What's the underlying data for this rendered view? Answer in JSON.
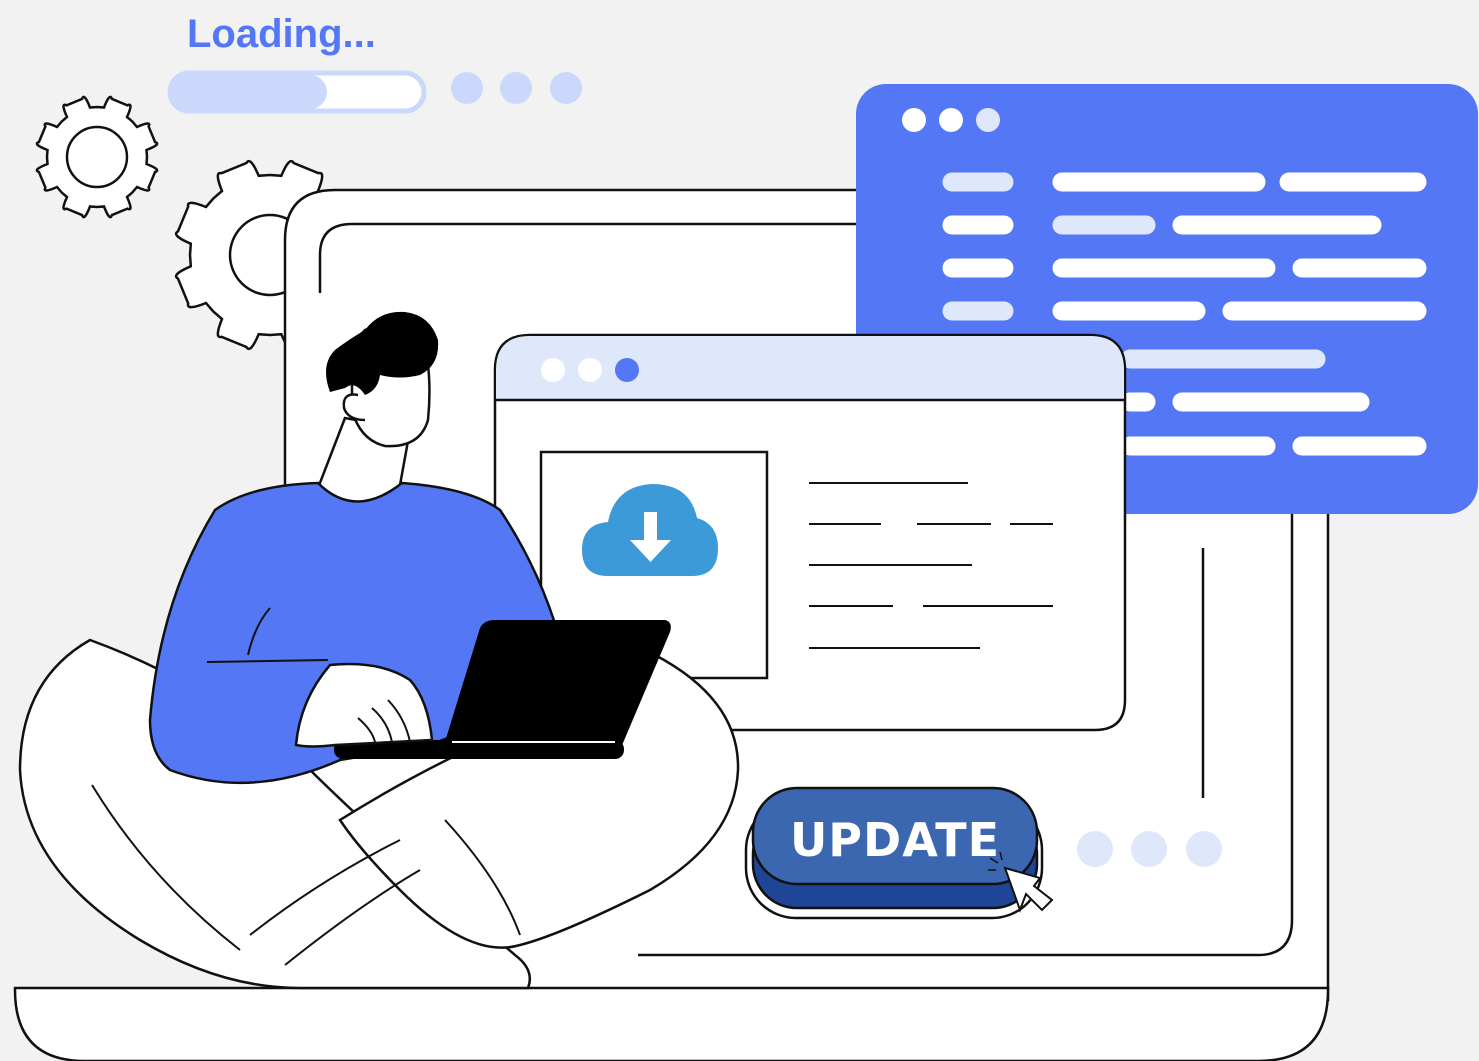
{
  "loading": {
    "label": "Loading...",
    "progress_fraction": 0.62
  },
  "update_button": {
    "label": "UPDATE"
  },
  "colors": {
    "background": "#f1f2f1",
    "accent": "#5478f5",
    "accent_light": "#c9d8fb",
    "panel_light": "#dfe7fb",
    "button": "#3b67b0",
    "button_shadow": "#1f4596",
    "cloud": "#3d9ad8",
    "outline": "#111111"
  },
  "icons": {
    "gear_small": "gear-icon",
    "gear_large": "gear-icon",
    "cloud_download": "cloud-download-icon",
    "cursor": "hand-cursor-icon"
  }
}
